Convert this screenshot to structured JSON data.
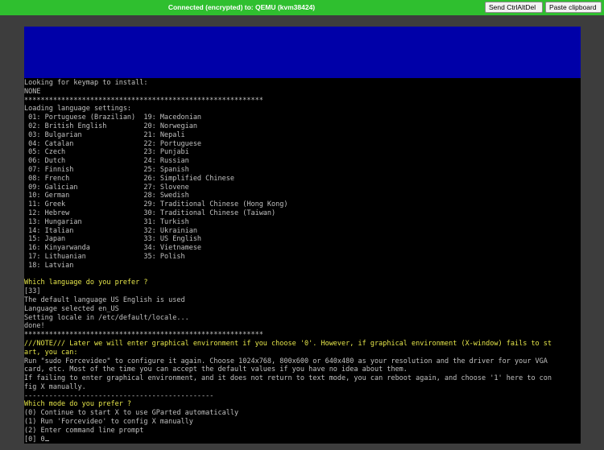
{
  "topbar": {
    "status": "Connected (encrypted) to: QEMU (kvm38424)",
    "ctrl_alt_del_label": "Send CtrlAltDel",
    "paste_label": "Paste clipboard",
    "bar_color": "#2fbf2f"
  },
  "console": {
    "banner_color": "#0000a8",
    "lines": [
      {
        "text": "Looking for keymap to install:",
        "style": "normal"
      },
      {
        "text": "NONE",
        "style": "normal"
      },
      {
        "text": "**********************************************************",
        "style": "normal"
      },
      {
        "text": "Loading language settings:",
        "style": "normal"
      },
      {
        "text": " 01: Portuguese (Brazilian)  19: Macedonian",
        "style": "normal"
      },
      {
        "text": " 02: British English         20: Norwegian",
        "style": "normal"
      },
      {
        "text": " 03: Bulgarian               21: Nepali",
        "style": "normal"
      },
      {
        "text": " 04: Catalan                 22: Portuguese",
        "style": "normal"
      },
      {
        "text": " 05: Czech                   23: Punjabi",
        "style": "normal"
      },
      {
        "text": " 06: Dutch                   24: Russian",
        "style": "normal"
      },
      {
        "text": " 07: Finnish                 25: Spanish",
        "style": "normal"
      },
      {
        "text": " 08: French                  26: Simplified Chinese",
        "style": "normal"
      },
      {
        "text": " 09: Galician                27: Slovene",
        "style": "normal"
      },
      {
        "text": " 10: German                  28: Swedish",
        "style": "normal"
      },
      {
        "text": " 11: Greek                   29: Traditional Chinese (Hong Kong)",
        "style": "normal"
      },
      {
        "text": " 12: Hebrew                  30: Traditional Chinese (Taiwan)",
        "style": "normal"
      },
      {
        "text": " 13: Hungarian               31: Turkish",
        "style": "normal"
      },
      {
        "text": " 14: Italian                 32: Ukrainian",
        "style": "normal"
      },
      {
        "text": " 15: Japan                   33: US English",
        "style": "normal"
      },
      {
        "text": " 16: Kinyarwanda             34: Vietnamese",
        "style": "normal"
      },
      {
        "text": " 17: Lithuanian              35: Polish",
        "style": "normal"
      },
      {
        "text": " 18: Latvian",
        "style": "normal"
      },
      {
        "text": "",
        "style": "normal"
      },
      {
        "text": "Which language do you prefer ?",
        "style": "yellow"
      },
      {
        "text": "[33]",
        "style": "normal"
      },
      {
        "text": "The default language US English is used",
        "style": "normal"
      },
      {
        "text": "Language selected en_US",
        "style": "normal"
      },
      {
        "text": "Setting locale in /etc/default/locale...",
        "style": "normal"
      },
      {
        "text": "done!",
        "style": "normal"
      },
      {
        "text": "**********************************************************",
        "style": "normal"
      },
      {
        "text": "///NOTE/// Later we will enter graphical environment if you choose '0'. However, if graphical environment (X-window) fails to st",
        "style": "yellow"
      },
      {
        "text": "art, you can:",
        "style": "yellow"
      },
      {
        "text": "Run \"sudo Forcevideo\" to configure it again. Choose 1024x768, 800x600 or 640x480 as your resolution and the driver for your VGA",
        "style": "normal"
      },
      {
        "text": "card, etc. Most of the time you can accept the default values if you have no idea about them.",
        "style": "normal"
      },
      {
        "text": "If failing to enter graphical environment, and it does not return to text mode, you can reboot again, and choose '1' here to con",
        "style": "normal"
      },
      {
        "text": "fig X manually.",
        "style": "normal"
      },
      {
        "text": "----------------------------------------------",
        "style": "normal"
      },
      {
        "text": "Which mode do you prefer ?",
        "style": "yellow"
      },
      {
        "text": "(0) Continue to start X to use GParted automatically",
        "style": "normal"
      },
      {
        "text": "(1) Run 'Forcevideo' to config X manually",
        "style": "normal"
      },
      {
        "text": "(2) Enter command line prompt",
        "style": "normal"
      }
    ],
    "prompt": "[0] 0"
  }
}
